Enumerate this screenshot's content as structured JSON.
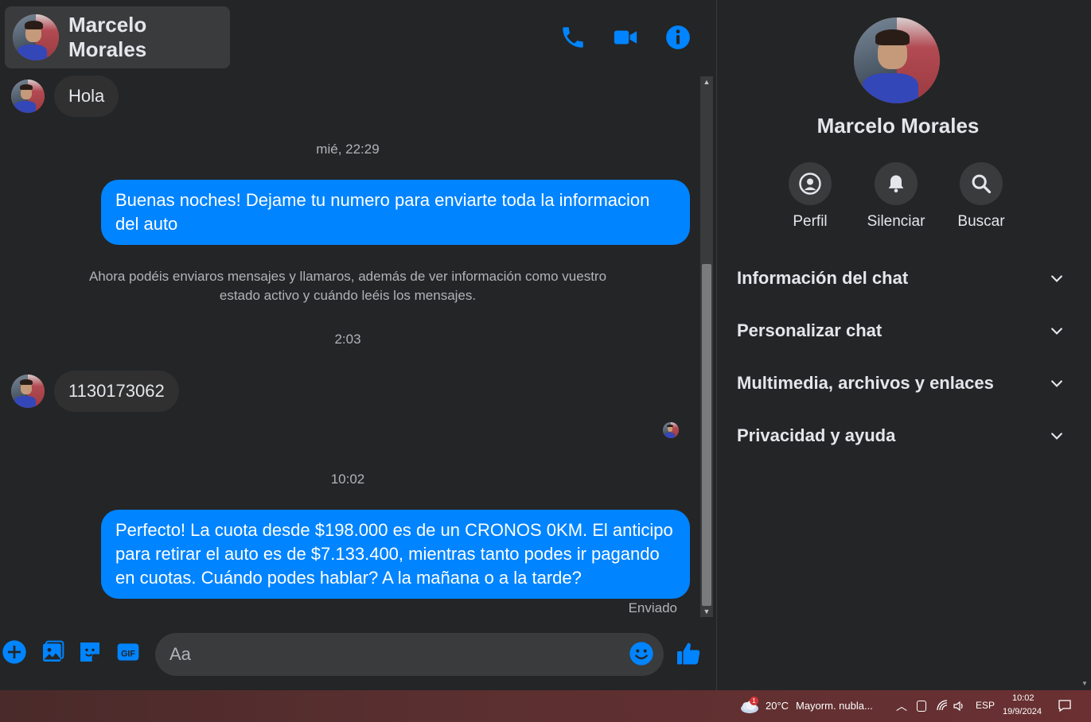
{
  "header": {
    "contact_name": "Marcelo Morales",
    "icons": [
      "phone-icon",
      "video-icon",
      "info-icon"
    ],
    "accent_color": "#0084ff"
  },
  "messages": {
    "incoming_1": "Hola",
    "timestamp_1": "mié, 22:29",
    "outgoing_1": "Buenas noches! Dejame tu numero para enviarte toda la informacion del auto",
    "system_note": "Ahora podéis enviaros mensajes y llamaros, además de ver información como vuestro estado activo y cuándo leéis los mensajes.",
    "timestamp_2": "2:03",
    "incoming_2": "1130173062",
    "timestamp_3": "10:02",
    "outgoing_2": "Perfecto! La cuota desde $198.000 es de un CRONOS 0KM. El anticipo para retirar el auto es de $7.133.400, mientras tanto podes ir pagando en cuotas. Cuándo podes hablar? A la mañana o a la tarde?",
    "sent_status": "Enviado"
  },
  "composer": {
    "placeholder": "Aa",
    "icons": [
      "plus-icon",
      "image-icon",
      "sticker-icon",
      "gif-icon",
      "emoji-icon",
      "thumbs-up-icon"
    ],
    "gif_label": "GIF"
  },
  "info_panel": {
    "name": "Marcelo Morales",
    "actions": [
      {
        "label": "Perfil",
        "icon": "profile-icon"
      },
      {
        "label": "Silenciar",
        "icon": "bell-icon"
      },
      {
        "label": "Buscar",
        "icon": "search-icon"
      }
    ],
    "sections": [
      {
        "label": "Información del chat"
      },
      {
        "label": "Personalizar chat"
      },
      {
        "label": "Multimedia, archivos y enlaces"
      },
      {
        "label": "Privacidad y ayuda"
      }
    ]
  },
  "taskbar": {
    "weather_badge": "1",
    "temperature": "20°C",
    "weather_text": "Mayorm. nubla...",
    "language": "ESP",
    "time": "10:02",
    "date": "19/9/2024"
  }
}
